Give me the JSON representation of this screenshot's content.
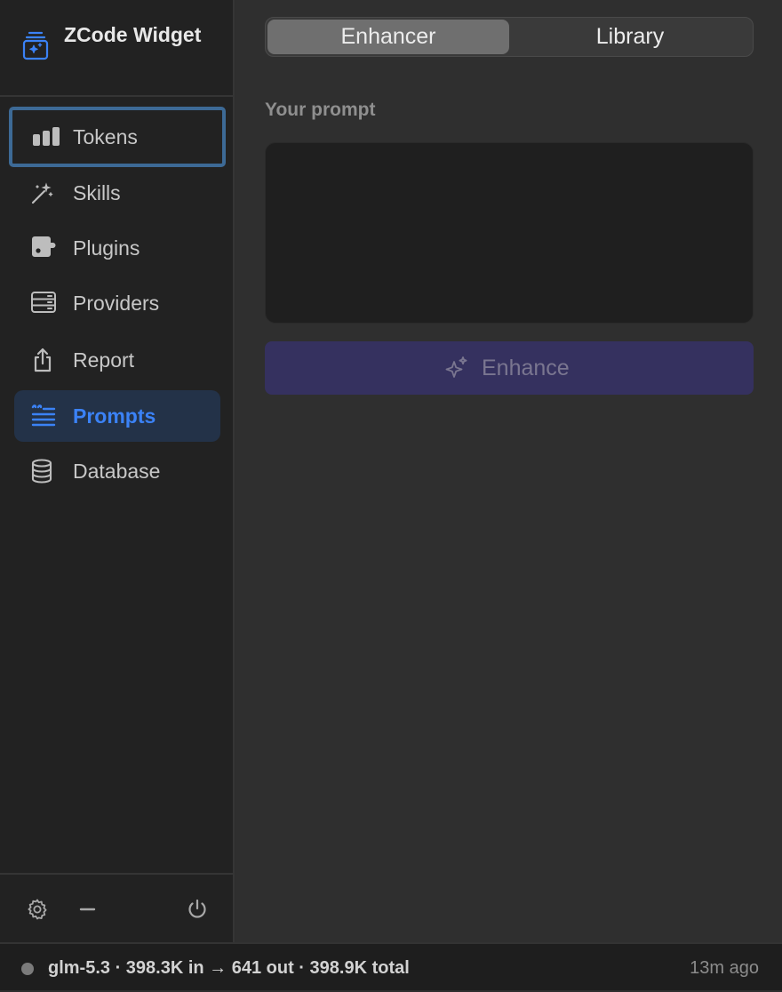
{
  "brand": {
    "title": "ZCode Widget",
    "icon": "app-logo-icon",
    "accent": "#3b82f6"
  },
  "sidebar": {
    "items": [
      {
        "label": "Tokens",
        "icon": "bar-chart-icon",
        "state": "focused"
      },
      {
        "label": "Skills",
        "icon": "magic-wand-icon",
        "state": "normal"
      },
      {
        "label": "Plugins",
        "icon": "plugin-icon",
        "state": "normal"
      },
      {
        "label": "Providers",
        "icon": "server-icon",
        "state": "normal"
      },
      {
        "label": "Report",
        "icon": "share-icon",
        "state": "normal"
      },
      {
        "label": "Prompts",
        "icon": "text-quote-icon",
        "state": "active"
      },
      {
        "label": "Database",
        "icon": "database-icon",
        "state": "normal"
      }
    ],
    "footer": {
      "settings": "gear-icon",
      "minimize": "minus-icon",
      "power": "power-icon"
    }
  },
  "main": {
    "tabs": [
      {
        "label": "Enhancer",
        "selected": true
      },
      {
        "label": "Library",
        "selected": false
      }
    ],
    "prompt_label": "Your prompt",
    "prompt_value": "",
    "enhance_label": "Enhance"
  },
  "status": {
    "text": "glm-5.3 · 398.3K in → 641 out · 398.9K total",
    "time": "13m ago"
  },
  "colors": {
    "active_bg": "#233248",
    "active_text": "#3b82f6",
    "focus_ring": "#3d6a96",
    "enhance_bg": "#35315f"
  }
}
